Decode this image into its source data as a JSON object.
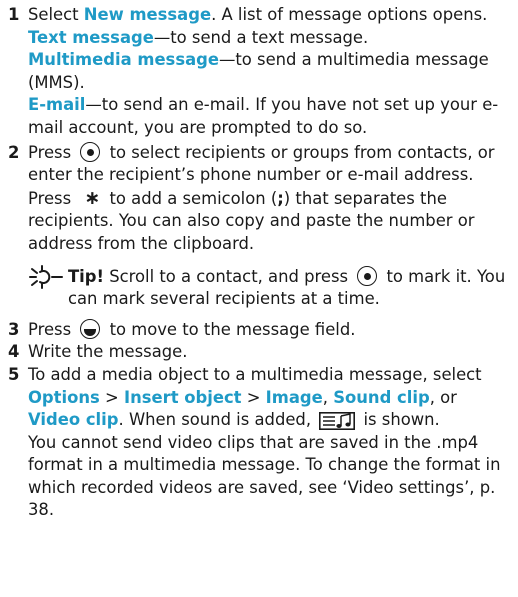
{
  "steps": [
    {
      "num": "1",
      "a": "Select ",
      "a_kw": "New message",
      "a_rest": ". A list of message options opens.",
      "opt1_kw": "Text message",
      "opt1_rest": "—to send a text message.",
      "opt2_kw": "Multimedia message",
      "opt2_rest": "—to send a multimedia message (MMS).",
      "opt3_kw": "E-mail",
      "opt3_rest": "—to send an e-mail. If you have not set up your e-mail account, you are prompted to do so."
    },
    {
      "num": "2",
      "a": "Press ",
      "b": " to select recipients or groups from contacts, or enter the recipient’s phone number or e-mail address. Press ",
      "c": " to add a semicolon (",
      "semicolon": ";",
      "d": ") that separates the recipients. You can also copy and paste the number or address from the clipboard.",
      "star": "∗"
    },
    {
      "num": "3",
      "a": "Press ",
      "b": " to move to the message field."
    },
    {
      "num": "4",
      "a": "Write the message."
    },
    {
      "num": "5",
      "a": "To add a media object to a multimedia message, select ",
      "kw_options": "Options",
      "sep1": " > ",
      "kw_insert": "Insert object",
      "sep2": " > ",
      "kw_image": "Image",
      "sep3": ", ",
      "kw_sound": "Sound clip",
      "sep4": ", or ",
      "kw_video": "Video clip",
      "b": ". When sound is added, ",
      "c": " is shown.",
      "note": "You cannot send video clips that are saved in the .mp4 format in a multimedia message. To change the format in which recorded videos are saved, see ‘Video settings’, p. 38."
    }
  ],
  "tip": {
    "label": "Tip!",
    "text1": " Scroll to a contact, and press ",
    "text2": " to mark it. You can mark several recipients at a time."
  },
  "icons": {
    "nav_center": "scroll-key-center-icon",
    "nav_down": "scroll-key-down-icon",
    "star": "star-key-icon",
    "tip": "tip-sun-icon",
    "audio": "audio-attachment-icon"
  },
  "colors": {
    "keyword": "#1f9ac6",
    "text": "#1a1a1a"
  }
}
